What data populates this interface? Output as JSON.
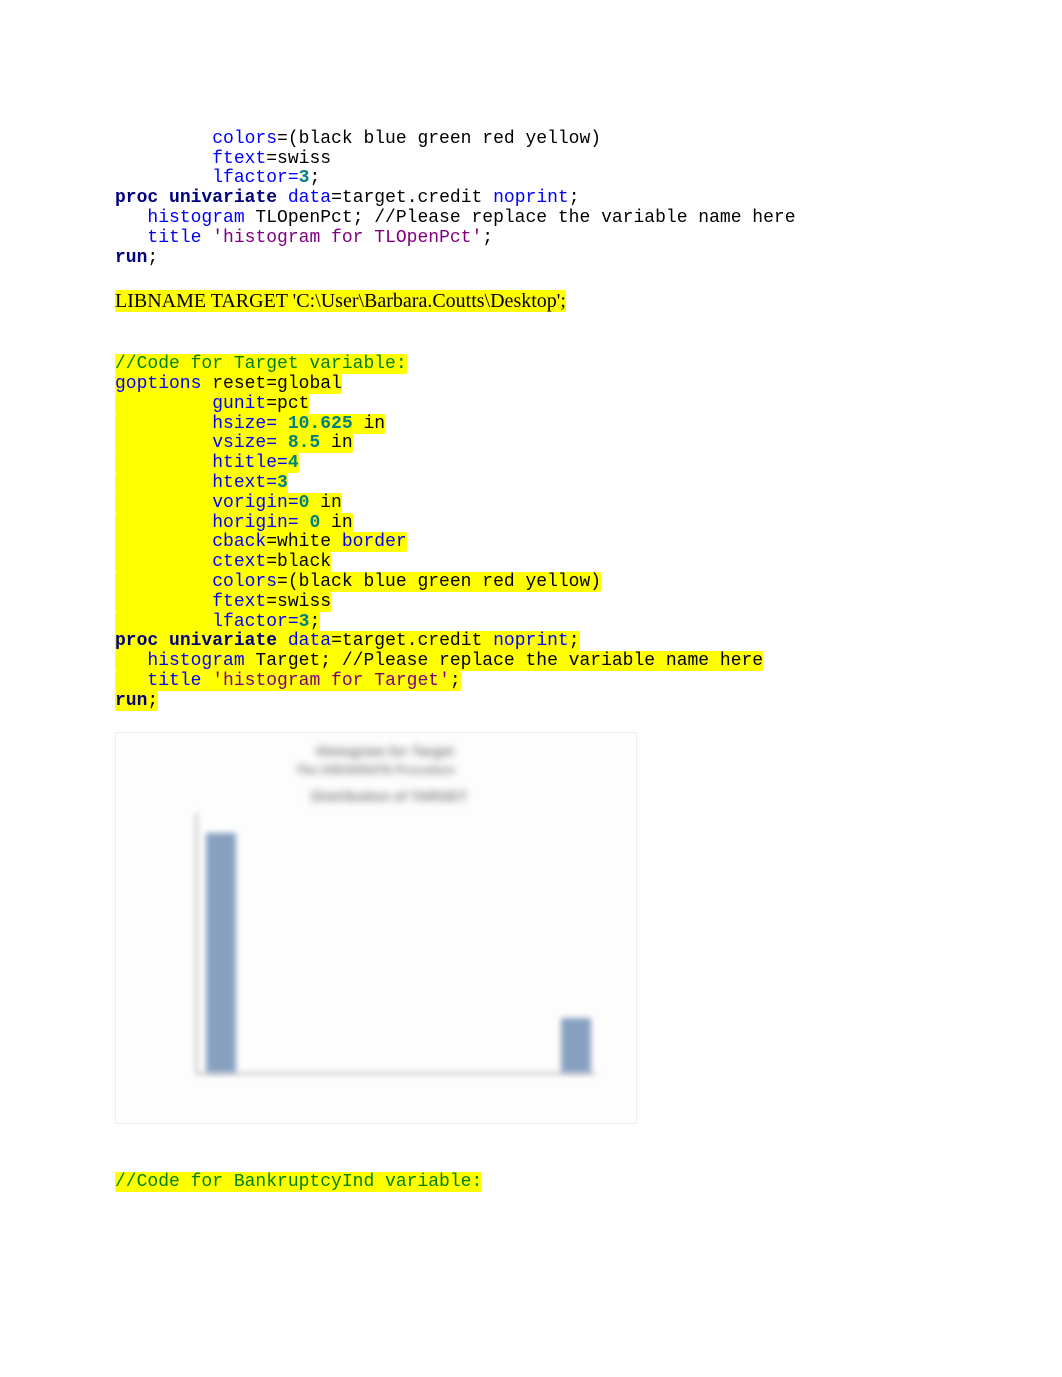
{
  "block1": {
    "l1a": "         colors",
    "l1b": "=(black blue green red yellow)",
    "l2a": "         ftext",
    "l2b": "=swiss",
    "l3a": "         lfactor=",
    "l3b": "3",
    "l3c": ";",
    "l4a": "proc",
    "l4b": " ",
    "l4c": "univariate",
    "l4d": " ",
    "l4e": "data",
    "l4f": "=target.credit ",
    "l4g": "noprint",
    "l4h": ";",
    "l5a": "   histogram",
    "l5b": " TLOpenPct; //Please replace the variable name here",
    "l6a": "   title",
    "l6b": " ",
    "l6c": "'histogram for TLOpenPct'",
    "l6d": ";",
    "l7a": "run",
    "l7b": ";"
  },
  "libname": "LIBNAME TARGET 'C:\\User\\Barbara.Coutts\\Desktop';",
  "block2": {
    "c1": "//Code for Target variable:",
    "l1a": "goptions",
    "l1b": " reset=global",
    "l2a": "         gunit",
    "l2b": "=pct",
    "l3a": "         hsize= ",
    "l3b": "10.625",
    "l3c": " in",
    "l4a": "         vsize= ",
    "l4b": "8.5",
    "l4c": " in",
    "l5a": "         htitle=",
    "l5b": "4",
    "l6a": "         htext=",
    "l6b": "3",
    "l7a": "         vorigin=",
    "l7b": "0",
    "l7c": " in",
    "l8a": "         horigin= ",
    "l8b": "0",
    "l8c": " in",
    "l9a": "         cback",
    "l9b": "=white ",
    "l9c": "border",
    "l10a": "         ctext",
    "l10b": "=black",
    "l11a": "         colors",
    "l11b": "=(black blue green red yellow)",
    "l12a": "         ftext",
    "l12b": "=swiss",
    "l13a": "         lfactor=",
    "l13b": "3",
    "l13c": ";",
    "p1a": "proc",
    "p1b": " ",
    "p1c": "univariate",
    "p1d": " ",
    "p1e": "data",
    "p1f": "=target.credit ",
    "p1g": "noprint",
    "p1h": ";",
    "p2a": "   histogram",
    "p2b": " Target; //Please replace the variable name here",
    "p3a": "   title",
    "p3b": " ",
    "p3c": "'histogram for Target'",
    "p3d": ";",
    "p4a": "run",
    "p4b": ";"
  },
  "block3": {
    "c1": "//Code for BankruptcyInd variable:"
  },
  "chart_img": {
    "title1": "Histogram for Target",
    "title2": "The UNIVARIATE Procedure",
    "title3": "Distribution of TARGET"
  }
}
